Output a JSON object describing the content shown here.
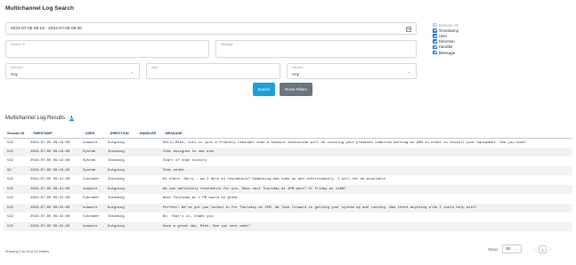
{
  "page": {
    "title": "Multichannel Log Search",
    "results_title": "Multichannel Log Results"
  },
  "filters": {
    "date_range": "2024-07-05 09:18 - 2024-07-05 09:30",
    "session_id_label": "Session ID",
    "message_label": "Message",
    "direction_label": "Direction",
    "direction_value": "Any",
    "user_label": "User",
    "user_value": "",
    "handler_label": "Handler",
    "handler_value": "Any"
  },
  "buttons": {
    "search": "Search",
    "reset": "Reset Filters"
  },
  "column_toggles": [
    {
      "label": "Session ID",
      "checked": true,
      "disabled": true
    },
    {
      "label": "Timestamp",
      "checked": true,
      "disabled": false
    },
    {
      "label": "User",
      "checked": true,
      "disabled": false
    },
    {
      "label": "Direction",
      "checked": true,
      "disabled": false
    },
    {
      "label": "Handler",
      "checked": true,
      "disabled": false
    },
    {
      "label": "Message",
      "checked": true,
      "disabled": false
    }
  ],
  "table": {
    "headers": [
      "Session ID",
      "TIMESTAMP",
      "USER",
      "DIRECTION",
      "HANDLER",
      "MESSAGE"
    ],
    "rows": [
      [
        "522",
        "2024-07-05 09:19:00",
        "sunwire",
        "Outgoing",
        "",
        "Hello Mike, this is just a friendly reminder that a Sunwire technician will be visiting your premises tomorrow morning at 9AM in order to install your equipment. See you soon!"
      ],
      [
        "522",
        "2024-07-05 09:19:00",
        "System",
        "Incoming",
        "",
        "Chat assigned to new user"
      ],
      [
        "522",
        "2024-07-05 09:19:00",
        "System",
        "Incoming",
        "",
        "Start of chat history"
      ],
      [
        "92",
        "2024-07-05 09:19:00",
        "System",
        "Outgoing",
        "",
        "Chat ended."
      ],
      [
        "522",
        "2024-07-05 09:21:00",
        "Customer",
        "Incoming",
        "",
        "Hi there. Sorry - am I able to reschedule? Something has come up and unfortunately, I will not be available."
      ],
      [
        "522",
        "2024-07-05 09:21:00",
        "sunwire",
        "Outgoing",
        "",
        "We can definitely reschedule for you. Does next Thursday at 1PM work? Or Friday at 11AM?"
      ],
      [
        "522",
        "2024-07-05 09:22:00",
        "Customer",
        "Incoming",
        "",
        "Next Thursday at 1 PM would be great."
      ],
      [
        "522",
        "2024-07-05 09:22:00",
        "sunwire",
        "Outgoing",
        "",
        "Perfect! We've got you locked in for Thursday at 1PM. We look forward to getting your system up and running. Was there anything else I could help with?"
      ],
      [
        "522",
        "2024-07-05 09:22:00",
        "Customer",
        "Incoming",
        "",
        "No. That's it, thank you."
      ],
      [
        "522",
        "2024-07-05 09:22:00",
        "sunwire",
        "Outgoing",
        "",
        "Have a great day, Mike. See you next week!"
      ]
    ]
  },
  "footer": {
    "info": "Showing 1 to 10 of 10 entries",
    "show_label": "Show:",
    "page_size": "50",
    "current_page": "1",
    "prev": "<",
    "next": ">"
  },
  "colors": {
    "primary": "#1aa1dc",
    "secondary": "#6c757d",
    "checkbox": "#1a7fd4",
    "header_text": "#1a3f70"
  }
}
